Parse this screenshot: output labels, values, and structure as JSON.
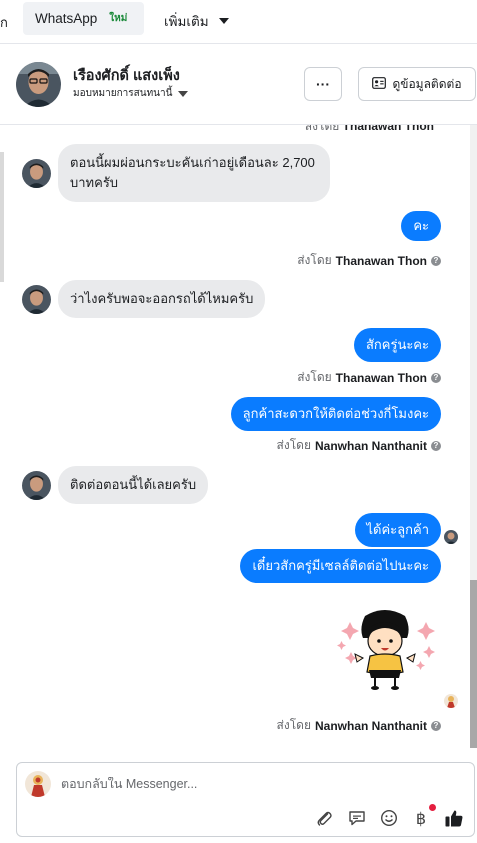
{
  "tabs": {
    "partial_label": "ก",
    "whatsapp_label": "WhatsApp",
    "whatsapp_badge": "ใหม่",
    "more_label": "เพิ่มเติม"
  },
  "header": {
    "contact_name": "เรืองศักดิ์ แสงเพ็ง",
    "assign_label": "มอบหมายการสนทนานี้",
    "more_button": "···",
    "contact_info_button": "ดูข้อมูลติดต่อ"
  },
  "chat": {
    "cut_off_sender": {
      "prefix": "ส่งโดย",
      "name": "Thanawan Thon"
    },
    "messages": [
      {
        "dir": "in",
        "text": "ตอนนี้ผมผ่อนกระบะคันเก่าอยู่เดือนละ 2,700 บาทครับ"
      },
      {
        "dir": "out",
        "text": "คะ"
      },
      {
        "dir": "meta",
        "prefix": "ส่งโดย",
        "name": "Thanawan Thon"
      },
      {
        "dir": "in",
        "text": "ว่าไงครับพอจะออกรถได้ไหมครับ"
      },
      {
        "dir": "out",
        "text": "สักครู่นะคะ"
      },
      {
        "dir": "meta",
        "prefix": "ส่งโดย",
        "name": "Thanawan Thon"
      },
      {
        "dir": "out",
        "text": "ลูกค้าสะดวกให้ติดต่อช่วงกี่โมงคะ"
      },
      {
        "dir": "meta",
        "prefix": "ส่งโดย",
        "name": "Nanwhan Nanthanit"
      },
      {
        "dir": "in",
        "text": "ติดต่อตอนนี้ได้เลยครับ"
      },
      {
        "dir": "out",
        "text": "ได้ค่ะลูกค้า"
      },
      {
        "dir": "out",
        "text": "เดี๋ยวสักครู่มีเซลล์ติดต่อไปนะคะ"
      },
      {
        "dir": "sticker",
        "text": ""
      },
      {
        "dir": "meta",
        "prefix": "ส่งโดย",
        "name": "Nanwhan Nanthanit"
      }
    ]
  },
  "composer": {
    "placeholder": "ตอบกลับใน Messenger...",
    "tools": [
      "paperclip-icon",
      "chat-bubble-icon",
      "smiley-icon",
      "baht-icon",
      "thumbs-up-icon"
    ],
    "baht_symbol": "฿"
  },
  "colors": {
    "outgoing_bubble": "#0a7cff",
    "incoming_bubble": "#e9eaec",
    "new_badge": "#1b8a3a"
  }
}
